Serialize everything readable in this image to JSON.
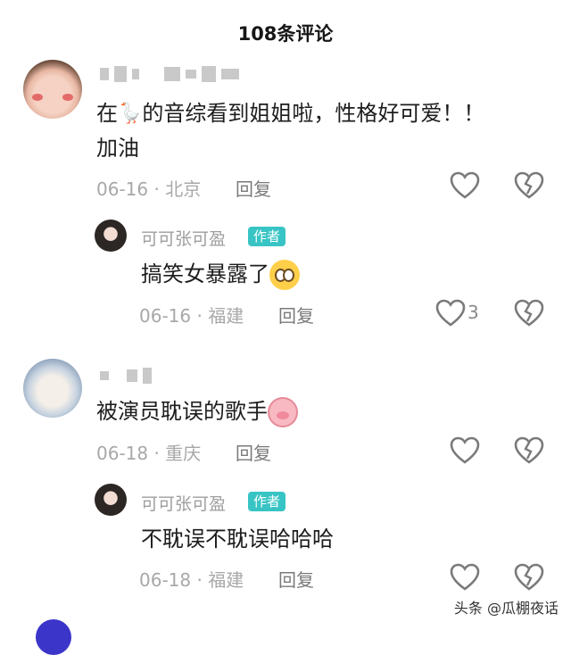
{
  "header": {
    "title": "108条评论"
  },
  "comments": [
    {
      "text_before": "在",
      "text_after": "的音综看到姐姐啦，性格好可爱！！",
      "text_line2": "加油",
      "goose_glyph": "🪿",
      "date": "06-16",
      "location": "北京",
      "reply_label": "回复",
      "reply": {
        "author": "可可张可盈",
        "badge": "作者",
        "text": "搞笑女暴露了",
        "date": "06-16",
        "location": "福建",
        "reply_label": "回复",
        "likes": "3"
      }
    },
    {
      "text": "被演员耽误的歌手",
      "date": "06-18",
      "location": "重庆",
      "reply_label": "回复",
      "reply": {
        "author": "可可张可盈",
        "badge": "作者",
        "text": "不耽误不耽误哈哈哈",
        "date": "06-18",
        "location": "福建",
        "reply_label": "回复"
      }
    }
  ],
  "watermark": "头条 @瓜棚夜话",
  "separator": "·",
  "colors": {
    "badge": "#38c4c4",
    "icon_stroke": "#7a7a7a"
  }
}
